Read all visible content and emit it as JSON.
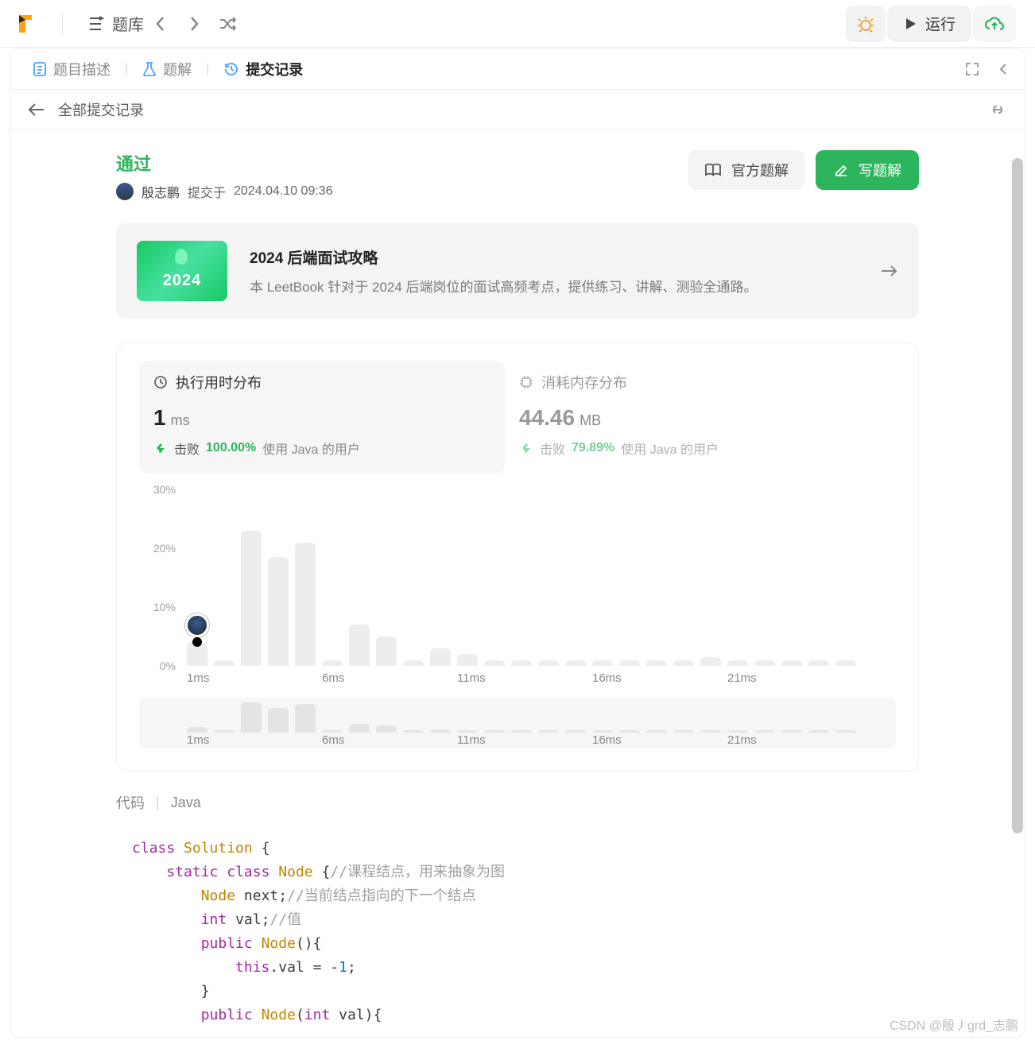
{
  "topbar": {
    "problems_label": "题库",
    "run_label": "运行"
  },
  "tabs": {
    "description": "题目描述",
    "solution": "题解",
    "submissions": "提交记录"
  },
  "subheader": {
    "back_label": "全部提交记录"
  },
  "status": {
    "pass_label": "通过",
    "username": "殷志鹏",
    "submitted_prefix": "提交于",
    "submitted_time": "2024.04.10 09:36"
  },
  "head_buttons": {
    "official_solution": "官方题解",
    "write_solution": "写题解"
  },
  "promo": {
    "year": "2024",
    "title": "2024 后端面试攻略",
    "desc": "本 LeetBook 针对于 2024 后端岗位的面试高频考点，提供练习、讲解、测验全通路。"
  },
  "stats": {
    "runtime_title": "执行用时分布",
    "memory_title": "消耗内存分布",
    "runtime_value": "1",
    "runtime_unit": "ms",
    "memory_value": "44.46",
    "memory_unit": "MB",
    "beats_label": "击败",
    "runtime_beats_pct": "100.00%",
    "memory_beats_pct": "79.89%",
    "beats_suffix": "使用 Java 的用户"
  },
  "chart_data": {
    "type": "bar",
    "ylabels": [
      "30%",
      "20%",
      "10%",
      "0%"
    ],
    "yvalues": [
      30,
      20,
      10,
      0
    ],
    "xlabels_main": [
      "1ms",
      "6ms",
      "11ms",
      "16ms",
      "21ms"
    ],
    "xlabels_mini": [
      "1ms",
      "6ms",
      "11ms",
      "16ms",
      "21ms"
    ],
    "main_bars_pct": [
      4,
      1,
      23,
      18.5,
      21,
      1,
      7,
      5,
      1,
      3,
      2,
      1,
      1,
      1,
      1,
      1,
      1,
      1,
      1,
      1.5,
      1,
      1,
      1,
      1,
      1
    ],
    "mini_bars_pct": [
      6,
      2,
      34,
      28,
      32,
      2,
      10,
      8,
      2,
      4,
      3,
      2,
      2,
      2,
      2,
      2,
      2,
      2,
      2,
      3,
      2,
      2,
      2,
      2,
      2
    ],
    "marker_index": 0
  },
  "code": {
    "label": "代码",
    "lang": "Java"
  },
  "watermark": "CSDN @殷丿grd_志鹏"
}
